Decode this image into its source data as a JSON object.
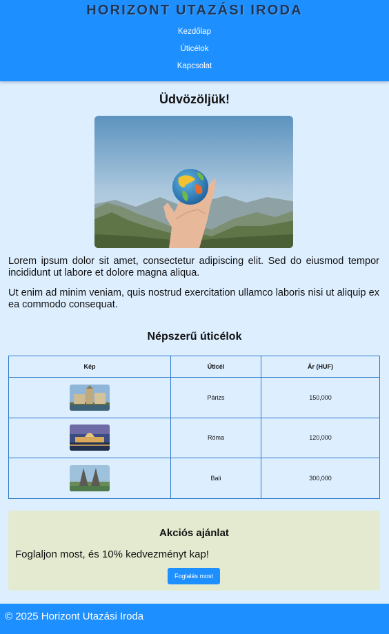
{
  "header": {
    "brand": "HORIZONT UTAZÁSI IRODA",
    "nav": [
      "Kezdőlap",
      "Úticélok",
      "Kapcsolat"
    ]
  },
  "main": {
    "welcome": "Üdvözöljük!",
    "paragraphs": [
      "Lorem ipsum dolor sit amet, consectetur adipiscing elit. Sed do eiusmod tempor incididunt ut labore et dolore magna aliqua.",
      "Ut enim ad minim veniam, quis nostrud exercitation ullamco laboris nisi ut aliquip ex ea commodo consequat."
    ]
  },
  "destinations": {
    "title": "Népszerű úticélok",
    "columns": [
      "Kép",
      "Úticél",
      "Ár (HUF)"
    ],
    "rows": [
      {
        "destination": "Párizs",
        "price": "150,000"
      },
      {
        "destination": "Róma",
        "price": "120,000"
      },
      {
        "destination": "Bali",
        "price": "300,000"
      }
    ]
  },
  "offer": {
    "title": "Akciós ajánlat",
    "text": "Foglaljon most, és 10% kedvezményt kap!",
    "button": "Foglalás most"
  },
  "footer": {
    "text": "© 2025 Horizont Utazási Iroda"
  },
  "colors": {
    "accent": "#1e8fff",
    "background": "#ddeeff",
    "offer_background": "#e4ead0",
    "table_border": "#2b78c8"
  }
}
